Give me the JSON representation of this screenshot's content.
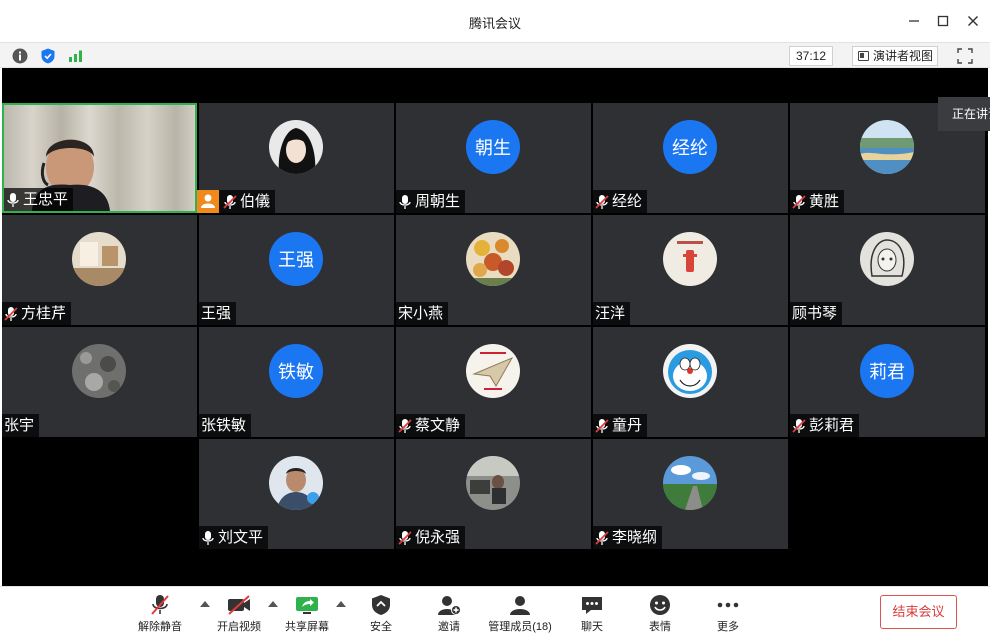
{
  "window": {
    "title": "腾讯会议"
  },
  "infobar": {
    "timer": "37:12",
    "speaker_view_label": "演讲者视图"
  },
  "talking_tooltip": "正在讲话",
  "participants": [
    {
      "name": "王忠平",
      "mic": "on",
      "type": "video"
    },
    {
      "name": "伯儀",
      "mic": "muted",
      "type": "avatar-image",
      "avatar": "anime-character",
      "host": true
    },
    {
      "name": "周朝生",
      "mic": "on",
      "type": "avatar-text",
      "avatar_text": "朝生"
    },
    {
      "name": "经纶",
      "mic": "muted",
      "type": "avatar-text",
      "avatar_text": "经纶"
    },
    {
      "name": "黄胜",
      "mic": "muted",
      "type": "avatar-image",
      "avatar": "lake-landscape"
    },
    {
      "name": "方桂芹",
      "mic": "muted",
      "type": "avatar-image",
      "avatar": "room-photo"
    },
    {
      "name": "王强",
      "mic": "none",
      "type": "avatar-text",
      "avatar_text": "王强"
    },
    {
      "name": "宋小燕",
      "mic": "none",
      "type": "avatar-image",
      "avatar": "flowers-painting"
    },
    {
      "name": "汪洋",
      "mic": "none",
      "type": "avatar-image",
      "avatar": "calligraphy-seal"
    },
    {
      "name": "顾书琴",
      "mic": "none",
      "type": "avatar-image",
      "avatar": "sketch-portrait"
    },
    {
      "name": "张宇",
      "mic": "none",
      "type": "avatar-image",
      "avatar": "gray-texture"
    },
    {
      "name": "张铁敏",
      "mic": "none",
      "type": "avatar-text",
      "avatar_text": "铁敏"
    },
    {
      "name": "蔡文静",
      "mic": "muted",
      "type": "avatar-image",
      "avatar": "paper-plane-card"
    },
    {
      "name": "童丹",
      "mic": "muted",
      "type": "avatar-image",
      "avatar": "doraemon"
    },
    {
      "name": "彭莉君",
      "mic": "muted",
      "type": "avatar-text",
      "avatar_text": "莉君"
    },
    {
      "name": "刘文平",
      "mic": "on",
      "type": "avatar-image",
      "avatar": "man-portrait"
    },
    {
      "name": "倪永强",
      "mic": "muted",
      "type": "avatar-image",
      "avatar": "office-photo"
    },
    {
      "name": "李晓纲",
      "mic": "muted",
      "type": "avatar-image",
      "avatar": "road-landscape"
    }
  ],
  "toolbar": {
    "unmute": "解除静音",
    "start_video": "开启视频",
    "share_screen": "共享屏幕",
    "security": "安全",
    "invite": "邀请",
    "manage_members": "管理成员(18)",
    "chat": "聊天",
    "reactions": "表情",
    "more": "更多",
    "end_meeting": "结束会议"
  },
  "colors": {
    "avatar_blue": "#1b76f2",
    "active_border": "#2fb24b",
    "host_badge": "#f08a1d",
    "end_red": "#d83b3b",
    "tile_bg": "#2e3034"
  }
}
